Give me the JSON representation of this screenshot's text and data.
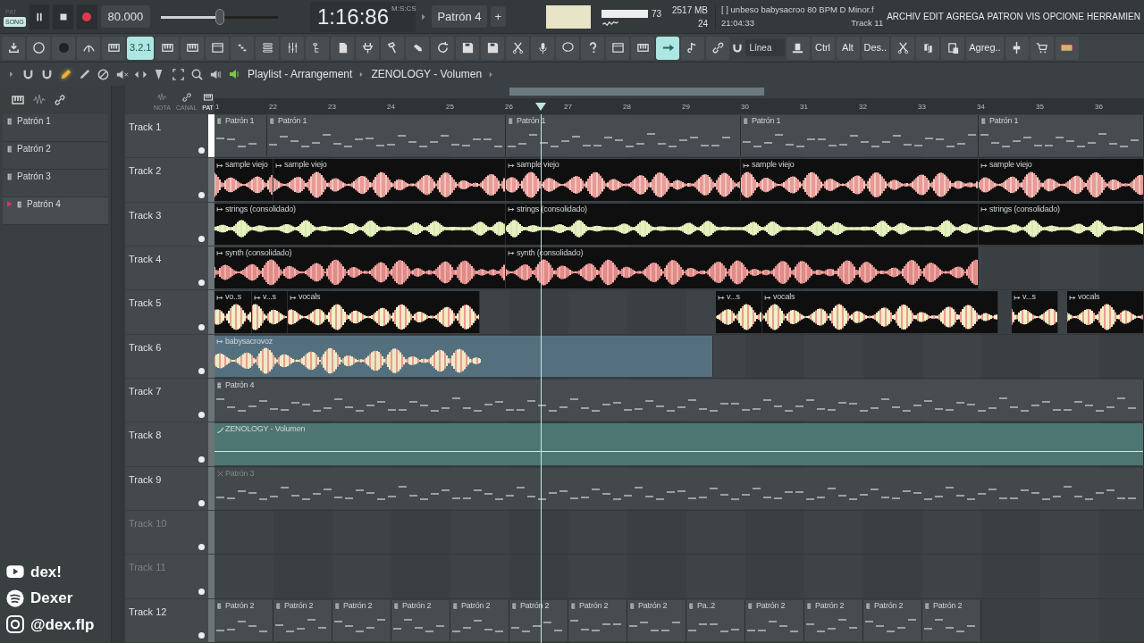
{
  "transport": {
    "modes": [
      {
        "label": "PAT",
        "selected": false
      },
      {
        "label": "SONG",
        "selected": true
      }
    ],
    "playing": true,
    "recording": true,
    "tempo": "80.000",
    "master_volume": {
      "level": 0.5
    },
    "time": "1:16:86",
    "time_format": "M:S:CS",
    "pattern": "Patrón 4",
    "add_pattern": "+"
  },
  "monitor": {
    "cpu": "73",
    "memory": "2517 MB",
    "polyphony": "24"
  },
  "hint": {
    "text": "[  ] unbeso babysacroo 80 BPM D Minor.f",
    "clock": "21:04:33",
    "track": "Track 11"
  },
  "menu": [
    "ARCHIV",
    "EDIT",
    "AGREGA",
    "PATRON",
    "VIS",
    "OPCIONE",
    "HERRAMIEN"
  ],
  "toolbar": [
    {
      "kind": "icon",
      "selected": false
    },
    {
      "kind": "icon",
      "selected": false
    },
    {
      "kind": "icon",
      "selected": false
    },
    {
      "kind": "icon",
      "selected": false
    },
    {
      "kind": "icon",
      "selected": false
    },
    {
      "kind": "text",
      "label": "3.2.1",
      "selected": true
    },
    {
      "kind": "icon",
      "selected": false
    },
    {
      "kind": "icon",
      "selected": false
    },
    {
      "kind": "icon",
      "selected": false
    },
    {
      "kind": "icon",
      "selected": false
    },
    {
      "kind": "icon",
      "selected": false
    },
    {
      "kind": "icon",
      "selected": false
    },
    {
      "kind": "icon",
      "selected": false
    },
    {
      "kind": "icon",
      "selected": false
    },
    {
      "kind": "icon",
      "selected": false
    },
    {
      "kind": "icon",
      "selected": false
    },
    {
      "kind": "icon",
      "selected": false
    },
    {
      "kind": "icon",
      "selected": false
    },
    {
      "kind": "icon",
      "selected": false
    },
    {
      "kind": "icon",
      "selected": false
    },
    {
      "kind": "icon",
      "selected": false
    },
    {
      "kind": "icon",
      "selected": false
    },
    {
      "kind": "icon",
      "selected": false
    },
    {
      "kind": "icon",
      "selected": false
    },
    {
      "kind": "icon",
      "selected": false
    },
    {
      "kind": "icon",
      "selected": false
    },
    {
      "kind": "icon",
      "selected": true
    },
    {
      "kind": "icon",
      "selected": false
    },
    {
      "kind": "icon",
      "selected": false
    },
    {
      "kind": "snap",
      "label": "Línea"
    },
    {
      "kind": "icon",
      "selected": false
    },
    {
      "kind": "text",
      "label": "Ctrl",
      "selected": false
    },
    {
      "kind": "text",
      "label": "Alt",
      "selected": false
    },
    {
      "kind": "text",
      "label": "Des..",
      "selected": false
    },
    {
      "kind": "icon",
      "selected": false
    },
    {
      "kind": "icon",
      "selected": false
    },
    {
      "kind": "icon",
      "selected": false
    },
    {
      "kind": "text",
      "label": "Agreg..",
      "selected": false
    },
    {
      "kind": "icon",
      "selected": false
    },
    {
      "kind": "icon",
      "selected": false
    },
    {
      "kind": "icon",
      "selected": false
    }
  ],
  "tools": [
    {
      "selected": false
    },
    {
      "selected": false
    },
    {
      "selected": true
    },
    {
      "selected": false
    },
    {
      "selected": false
    },
    {
      "selected": false
    },
    {
      "selected": false
    },
    {
      "selected": false
    },
    {
      "selected": false
    },
    {
      "selected": false
    },
    {
      "selected": false
    }
  ],
  "breadcrumb": [
    "Playlist - Arrangement",
    "ZENOLOGY - Volumen"
  ],
  "picker_tabs": [
    {
      "label": "NOTA",
      "selected": false
    },
    {
      "label": "CANAL",
      "selected": false
    },
    {
      "label": "PAT",
      "selected": true
    }
  ],
  "patterns": [
    {
      "label": "Patrón 1",
      "selected": false
    },
    {
      "label": "Patrón 2",
      "selected": false
    },
    {
      "label": "Patrón 3",
      "selected": false
    },
    {
      "label": "Patrón 4",
      "selected": true
    }
  ],
  "ruler": [
    "1",
    "22",
    "23",
    "24",
    "25",
    "26",
    "27",
    "28",
    "29",
    "30",
    "31",
    "32",
    "33",
    "34",
    "35",
    "36"
  ],
  "tracks": [
    {
      "name": "Track 1",
      "active": true,
      "clips": [
        {
          "kind": "pattern",
          "label": "Patrón 1"
        },
        {
          "kind": "pattern",
          "label": "Patrón 1"
        },
        {
          "kind": "pattern",
          "label": "Patrón 1"
        },
        {
          "kind": "pattern",
          "label": "Patrón 1"
        },
        {
          "kind": "pattern",
          "label": "Patrón 1"
        }
      ]
    },
    {
      "name": "Track 2",
      "active": true,
      "clips": [
        {
          "kind": "audio",
          "label": "sample viejo"
        },
        {
          "kind": "audio",
          "label": "sample viejo"
        },
        {
          "kind": "audio",
          "label": "sample viejo"
        },
        {
          "kind": "audio",
          "label": "sample viejo"
        },
        {
          "kind": "audio",
          "label": "sample viejo"
        }
      ]
    },
    {
      "name": "Track 3",
      "active": true,
      "clips": [
        {
          "kind": "audio",
          "label": "strings (consolidado)"
        },
        {
          "kind": "audio",
          "label": "strings (consolidado)"
        },
        {
          "kind": "audio",
          "label": "strings (consolidado)"
        }
      ]
    },
    {
      "name": "Track 4",
      "active": true,
      "clips": [
        {
          "kind": "audio",
          "label": "synth (consolidado)"
        },
        {
          "kind": "audio",
          "label": "synth (consolidado)"
        }
      ]
    },
    {
      "name": "Track 5",
      "active": true,
      "clips": [
        {
          "kind": "audio",
          "label": "vo..s"
        },
        {
          "kind": "audio",
          "label": "v...s"
        },
        {
          "kind": "audio",
          "label": "vocals"
        },
        {
          "kind": "audio",
          "label": "v...s"
        },
        {
          "kind": "audio",
          "label": "vocals"
        },
        {
          "kind": "audio",
          "label": "v...s"
        },
        {
          "kind": "audio",
          "label": "vocals"
        }
      ]
    },
    {
      "name": "Track 6",
      "active": true,
      "clips": [
        {
          "kind": "audio",
          "label": "babysacrovoz"
        }
      ]
    },
    {
      "name": "Track 7",
      "active": true,
      "clips": [
        {
          "kind": "pattern",
          "label": "Patrón 4"
        }
      ]
    },
    {
      "name": "Track 8",
      "active": true,
      "clips": [
        {
          "kind": "automation",
          "label": "ZENOLOGY - Volumen"
        }
      ]
    },
    {
      "name": "Track 9",
      "active": true,
      "clips": [
        {
          "kind": "muted",
          "label": "Patrón 3"
        }
      ]
    },
    {
      "name": "Track 10",
      "active": false
    },
    {
      "name": "Track 11",
      "active": false
    },
    {
      "name": "Track 12",
      "active": true,
      "clips": [
        {
          "kind": "pattern",
          "label": "Patrón 2"
        },
        {
          "kind": "pattern",
          "label": "Patrón 2"
        },
        {
          "kind": "pattern",
          "label": "Patrón 2"
        },
        {
          "kind": "pattern",
          "label": "Patrón 2"
        },
        {
          "kind": "pattern",
          "label": "Patrón 2"
        },
        {
          "kind": "pattern",
          "label": "Patrón 2"
        },
        {
          "kind": "pattern",
          "label": "Patrón 2"
        },
        {
          "kind": "pattern",
          "label": "Patrón 2"
        },
        {
          "kind": "pattern",
          "label": "Pa..2"
        },
        {
          "kind": "pattern",
          "label": "Patrón 2"
        },
        {
          "kind": "pattern",
          "label": "Patrón 2"
        },
        {
          "kind": "pattern",
          "label": "Patrón 2"
        },
        {
          "kind": "pattern",
          "label": "Patrón 2"
        }
      ]
    }
  ],
  "social": [
    {
      "kind": "youtube",
      "label": "dex!"
    },
    {
      "kind": "spotify",
      "label": "Dexer"
    },
    {
      "kind": "instagram",
      "label": "@dex.flp"
    }
  ]
}
